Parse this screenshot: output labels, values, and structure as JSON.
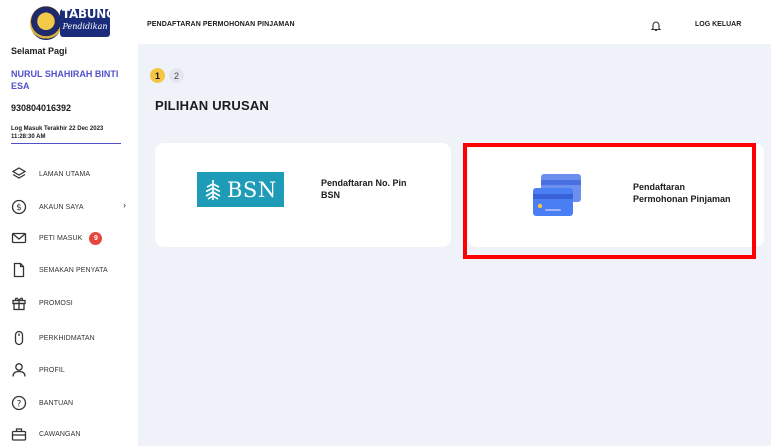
{
  "logo": {
    "title": "TABUNG",
    "subtitle": "Pendidikan"
  },
  "user": {
    "greeting": "Selamat Pagi",
    "name": "NURUL SHAHIRAH BINTI ESA",
    "id": "930804016392",
    "last_login": "Log Masuk Terakhir 22 Dec 2023 11:28:30 AM"
  },
  "nav": [
    {
      "label": "LAMAN UTAMA",
      "icon": "layers-icon"
    },
    {
      "label": "AKAUN SAYA",
      "icon": "dollar-circle-icon"
    },
    {
      "label": "PETI MASUK",
      "icon": "mail-icon",
      "badge": "9"
    },
    {
      "label": "SEMAKAN PENYATA",
      "icon": "document-icon"
    },
    {
      "label": "PROMOSI",
      "icon": "gift-icon"
    },
    {
      "label": "PERKHIDMATAN",
      "icon": "mouse-icon"
    },
    {
      "label": "PROFIL",
      "icon": "user-icon"
    },
    {
      "label": "BANTUAN",
      "icon": "help-icon"
    },
    {
      "label": "CAWANGAN",
      "icon": "branch-icon"
    }
  ],
  "topbar": {
    "title": "PENDAFTARAN PERMOHONAN PINJAMAN",
    "logout": "LOG KELUAR"
  },
  "steps": [
    "1",
    "2"
  ],
  "section_title": "PILIHAN URUSAN",
  "cards": [
    {
      "label_line1": "Pendaftaran No. Pin",
      "label_line2": "BSN",
      "logo_text": "BSN"
    },
    {
      "label_line1": "Pendaftaran",
      "label_line2": "Permohonan Pinjaman"
    }
  ],
  "colors": {
    "accent": "#5152c9",
    "step_active": "#f6c543",
    "bsn": "#1d9bb7",
    "badge": "#e5463d",
    "highlight": "#ff0000",
    "background": "#f0f2fa"
  }
}
